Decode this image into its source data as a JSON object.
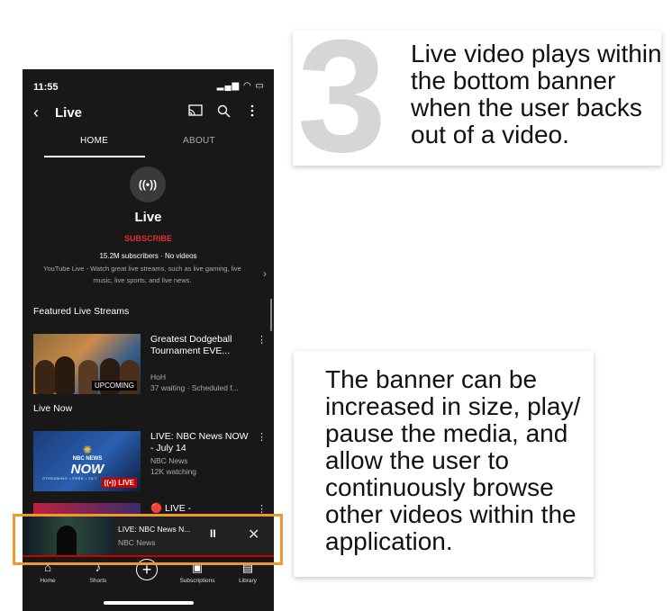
{
  "status_bar": {
    "time": "11:55",
    "signal": "▂▄▆",
    "wifi": "◠",
    "battery": "▭"
  },
  "header": {
    "back": "‹",
    "title": "Live",
    "icons": [
      "cast-icon",
      "search-icon",
      "more-vert-icon"
    ]
  },
  "tabs": [
    {
      "label": "HOME"
    },
    {
      "label": "ABOUT"
    }
  ],
  "channel": {
    "avatar_glyph": "((•))",
    "name": "Live",
    "subscribe_label": "SUBSCRIBE",
    "subscribers": "15.2M subscribers · No videos",
    "description": "YouTube Live - Watch great live streams, such as live gaming, live music, live sports, and live news."
  },
  "sections": {
    "featured": "Featured Live Streams",
    "live_now": "Live Now"
  },
  "videos": [
    {
      "title": "Greatest Dodgeball Tournament EVE...",
      "channel": "HoH",
      "meta": "37 waiting · Scheduled f...",
      "badge": "UPCOMING"
    },
    {
      "title": "LIVE: NBC News NOW - July 14",
      "channel": "NBC News",
      "meta": "12K watching",
      "badge": "LIVE",
      "thumb_small": "NBC NEWS",
      "thumb_big": "NOW",
      "thumb_strip": "STREAMING • FREE • 24/7"
    },
    {
      "title": "🔴 LIVE -"
    }
  ],
  "mini_player": {
    "title": "LIVE: NBC News N...",
    "channel": "NBC News",
    "pause": "II",
    "close": "✕"
  },
  "bottom_nav": [
    {
      "label": "Home"
    },
    {
      "label": "Shorts"
    },
    {
      "label": ""
    },
    {
      "label": "Subscriptions"
    },
    {
      "label": "Library"
    }
  ],
  "annotations": {
    "step_number": "3",
    "note1": "Live video plays within the bottom banner when the user backs out of a video.",
    "note2": "The banner can be increased in size, play/ pause the media, and allow the user to continuously browse other videos within the application."
  },
  "colors": {
    "subscribe": "#e0302b",
    "highlight": "#f0982f",
    "live": "#cc0000"
  }
}
